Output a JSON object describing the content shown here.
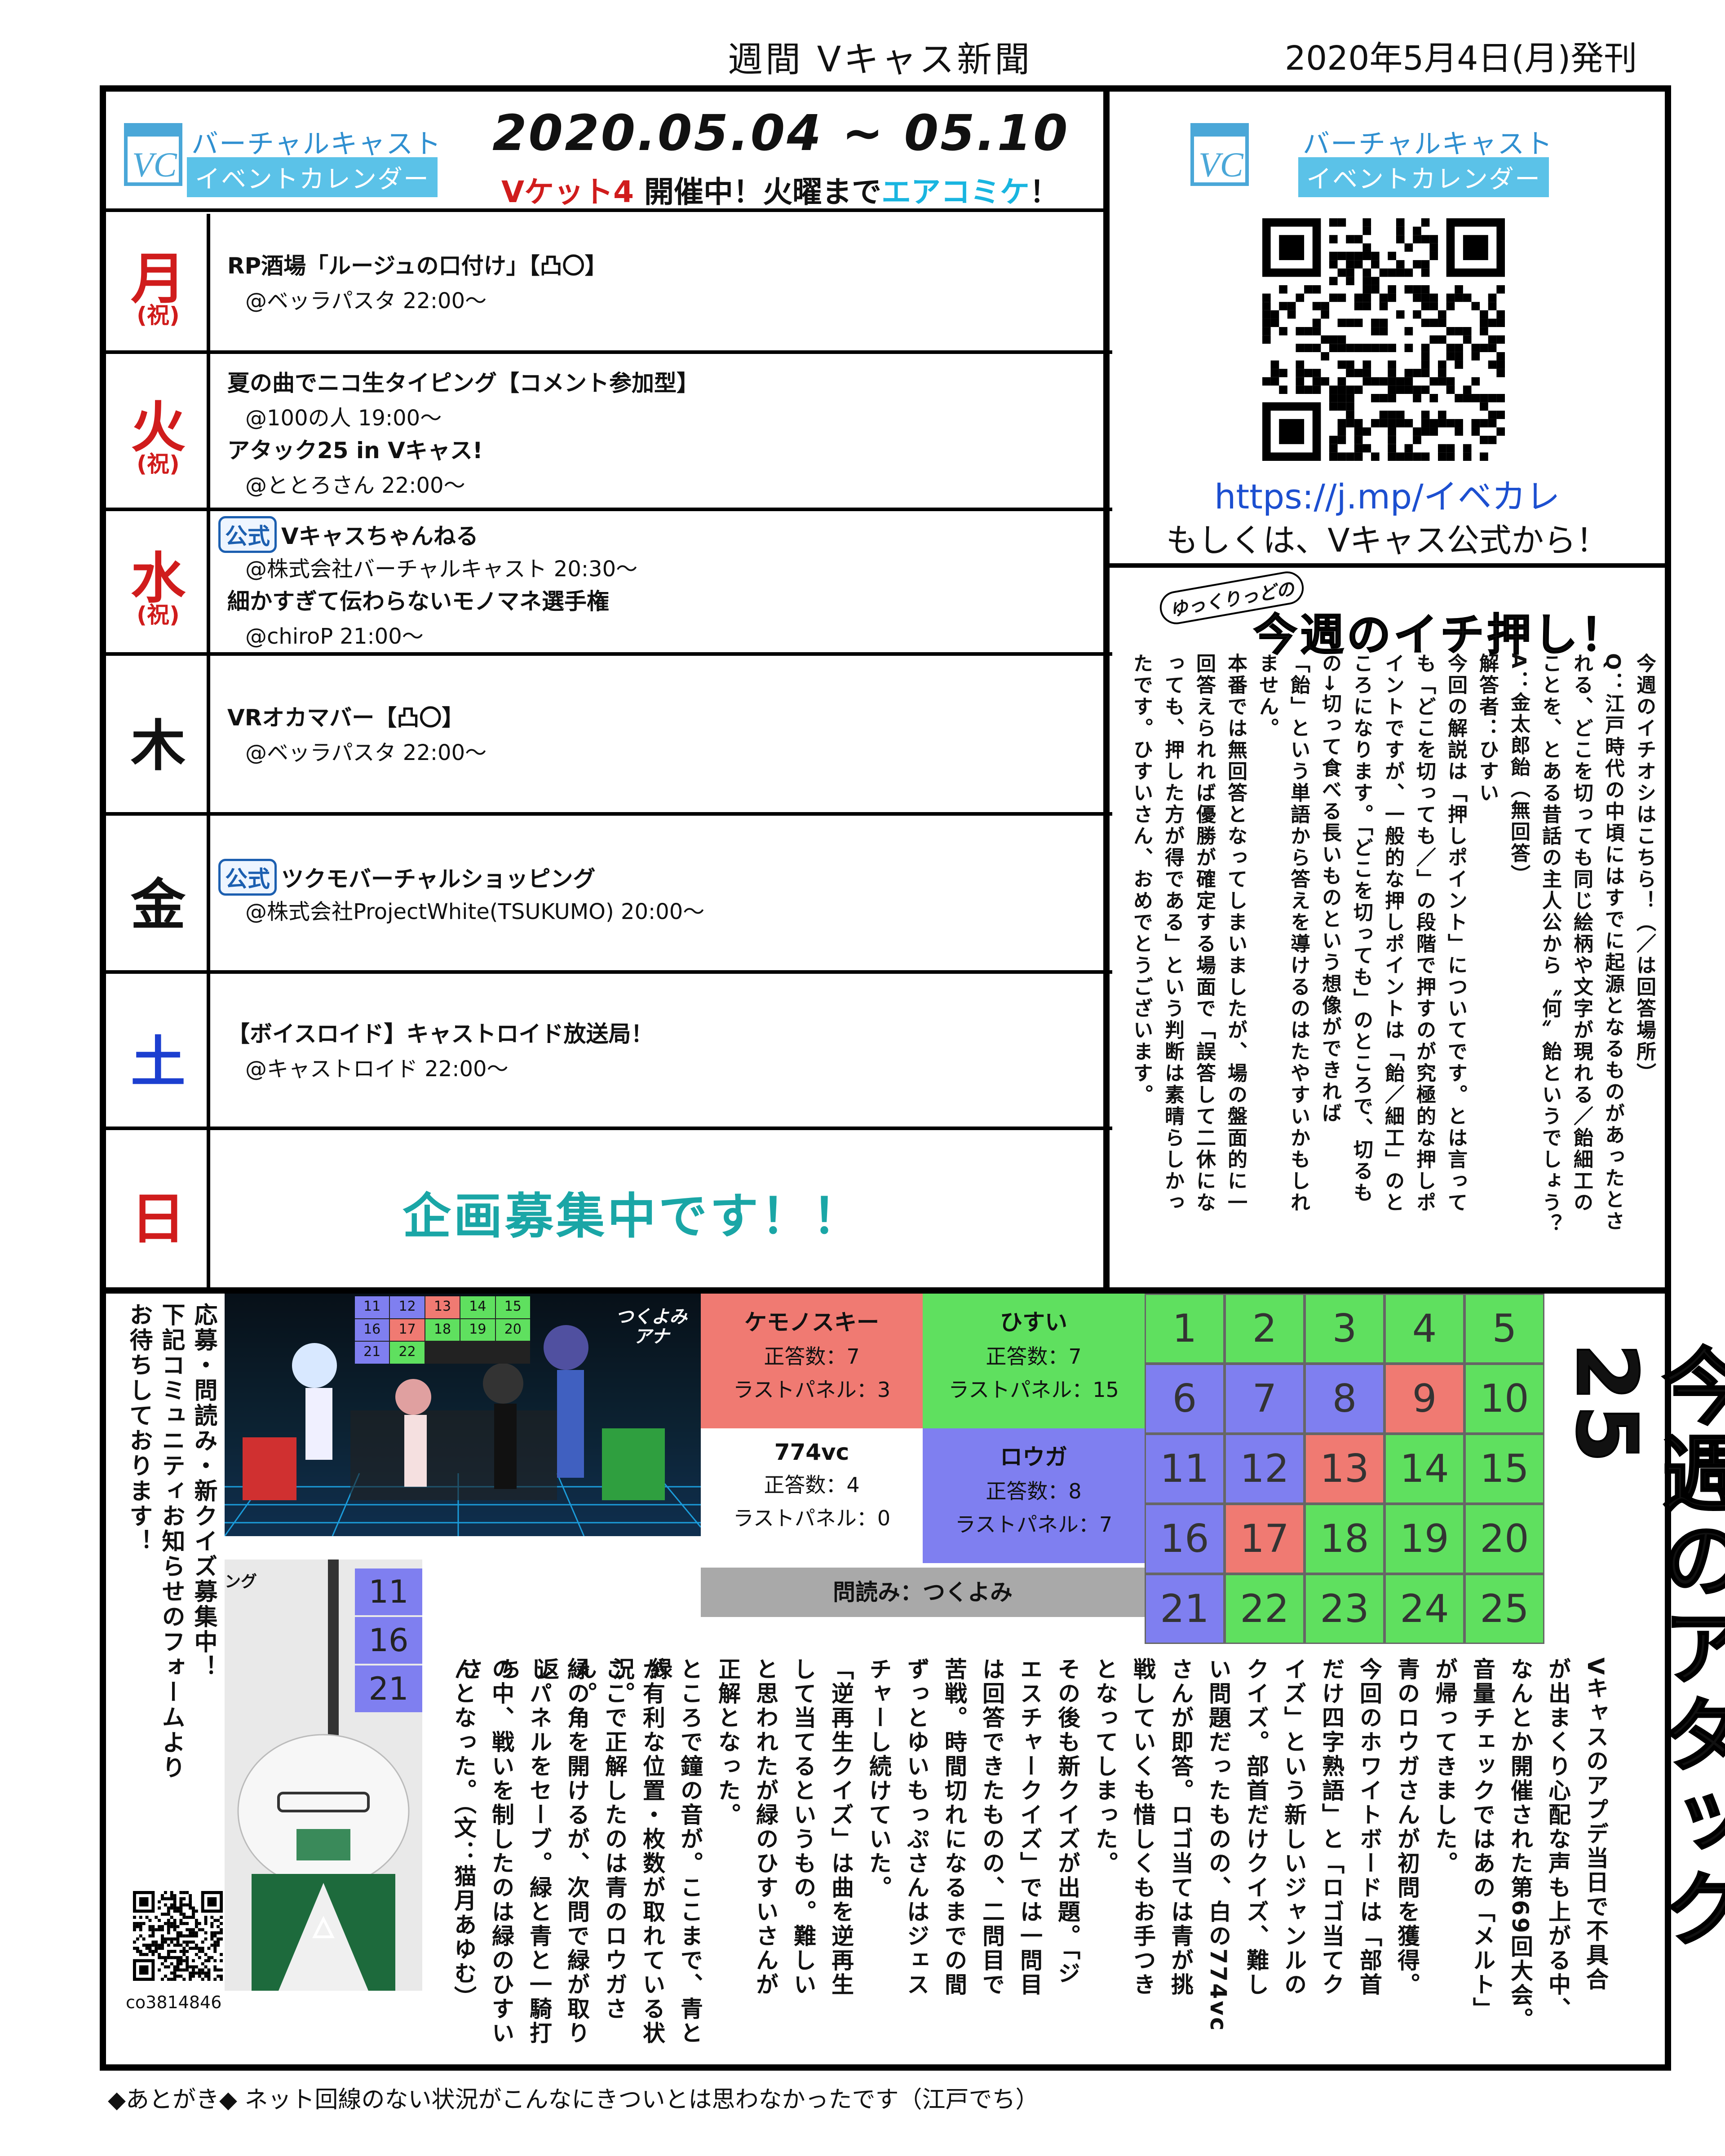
{
  "masthead": {
    "title": "週間 Vキャス新聞",
    "date": "2020年5月4日(月)発刊"
  },
  "logo": {
    "mark": "VC",
    "line1": "バーチャルキャスト",
    "line2": "イベントカレンダー"
  },
  "header": {
    "date_range": "2020.05.04 ~ 05.10",
    "notice_part1": "Vケット4",
    "notice_part2": " 開催中！火曜まで",
    "notice_part3": "エアコミケ",
    "notice_part4": "！"
  },
  "schedule": [
    {
      "day": "月",
      "holiday": "(祝)",
      "color": "#d01c1c",
      "events": [
        {
          "official": "",
          "title": "RP酒場「ルージュの口付け」【凸〇】",
          "host": "@ベッラパスタ 22:00～"
        }
      ]
    },
    {
      "day": "火",
      "holiday": "(祝)",
      "color": "#d01c1c",
      "events": [
        {
          "official": "",
          "title": "夏の曲でニコ生タイピング【コメント参加型】",
          "host": "@100の人 19:00～"
        },
        {
          "official": "",
          "title": "アタック25 in Vキャス!",
          "host": "@ととろさん 22:00～"
        }
      ]
    },
    {
      "day": "水",
      "holiday": "(祝)",
      "color": "#d01c1c",
      "events": [
        {
          "official": "公式",
          "title": "Vキャスちゃんねる",
          "host": "@株式会社バーチャルキャスト 20:30～"
        },
        {
          "official": "",
          "title": "細かすぎて伝わらないモノマネ選手権",
          "host": "@chiroP 21:00～"
        }
      ]
    },
    {
      "day": "木",
      "holiday": "",
      "color": "#111111",
      "events": [
        {
          "official": "",
          "title": "VRオカマバー【凸〇】",
          "host": "@ベッラパスタ 22:00～"
        }
      ]
    },
    {
      "day": "金",
      "holiday": "",
      "color": "#111111",
      "events": [
        {
          "official": "公式",
          "title": "ツクモバーチャルショッピング",
          "host": "@株式会社ProjectWhite(TSUKUMO) 20:00～"
        }
      ]
    },
    {
      "day": "土",
      "holiday": "",
      "color": "#1c3fd0",
      "events": [
        {
          "official": "",
          "title": "【ボイスロイド】キャストロイド放送局！",
          "host": "@キャストロイド 22:00～"
        }
      ]
    },
    {
      "day": "日",
      "holiday": "",
      "color": "#d01c1c",
      "events": [],
      "recruit": "企画募集中です！！"
    }
  ],
  "qr_panel": {
    "url": "https://j.mp/イベカレ",
    "alt_text": "もしくは、Vキャス公式から！"
  },
  "pick": {
    "badge": "ゆっくりっどの",
    "title": "今週のイチ押し！",
    "columns": [
      "今週のイチオシはこちら！（／は回答場所）",
      "Q：江戸時代の中頃にはすでに起源となるものがあったとさ",
      "れる、どこを切っても同じ絵柄や文字が現れる／飴細工の",
      "ことを、とある昔話の主人公から〝何〟飴というでしょう？",
      "A：金太郎飴（無回答）",
      "解答者：ひすい",
      "今回の解説は「押しポイント」についてです。とは言って",
      "も「どこを切っても／」の段階で押すのが究極的な押しポ",
      "イントですが、一般的な押しポイントは「飴／細工」のと",
      "ころになります。「どこを切っても」のところで、切るも",
      "の→切って食べる長いものという想像ができれば",
      "「飴」という単語から答えを導けるのはたやすいかもしれ",
      "ません。",
      "本番では無回答となってしまいましたが、場の盤面的に一",
      "回答えられれば優勝が確定する場面で「誤答して二休にな",
      "っても、押した方が得である」という判断は素晴らしかっ",
      "たです。ひすいさん、おめでとうございます。"
    ]
  },
  "attack25": {
    "title": "今週のアタック25",
    "teams": [
      {
        "name": "ケモノスキー",
        "correct": "正答数：7",
        "last": "ラストパネル：3",
        "color": "#f07a72"
      },
      {
        "name": "ひすい",
        "correct": "正答数：7",
        "last": "ラストパネル：15",
        "color": "#5fe05f"
      },
      {
        "name": "774vc",
        "correct": "正答数：4",
        "last": "ラストパネル：0",
        "color": "#ffffff"
      },
      {
        "name": "ロウガ",
        "correct": "正答数：8",
        "last": "ラストパネル：7",
        "color": "#7f7ff0"
      }
    ],
    "reader": "問読み：つくよみ",
    "panels": [
      {
        "n": "1",
        "c": "#5fe05f"
      },
      {
        "n": "2",
        "c": "#5fe05f"
      },
      {
        "n": "3",
        "c": "#5fe05f"
      },
      {
        "n": "4",
        "c": "#5fe05f"
      },
      {
        "n": "5",
        "c": "#5fe05f"
      },
      {
        "n": "6",
        "c": "#7f7ff0"
      },
      {
        "n": "7",
        "c": "#7f7ff0"
      },
      {
        "n": "8",
        "c": "#7f7ff0"
      },
      {
        "n": "9",
        "c": "#f07a72"
      },
      {
        "n": "10",
        "c": "#5fe05f"
      },
      {
        "n": "11",
        "c": "#7f7ff0"
      },
      {
        "n": "12",
        "c": "#7f7ff0"
      },
      {
        "n": "13",
        "c": "#f07a72"
      },
      {
        "n": "14",
        "c": "#5fe05f"
      },
      {
        "n": "15",
        "c": "#5fe05f"
      },
      {
        "n": "16",
        "c": "#7f7ff0"
      },
      {
        "n": "17",
        "c": "#f07a72"
      },
      {
        "n": "18",
        "c": "#5fe05f"
      },
      {
        "n": "19",
        "c": "#5fe05f"
      },
      {
        "n": "20",
        "c": "#5fe05f"
      },
      {
        "n": "21",
        "c": "#7f7ff0"
      },
      {
        "n": "22",
        "c": "#5fe05f"
      },
      {
        "n": "23",
        "c": "#5fe05f"
      },
      {
        "n": "24",
        "c": "#5fe05f"
      },
      {
        "n": "25",
        "c": "#5fe05f"
      }
    ],
    "article_columns": [
      "Vキャスのアプデ当日で不具合",
      "が出まくり心配な声も上がる中、",
      "なんとか開催された第69回大会。",
      "音量チェックではあの「メルト」",
      "が帰ってきました。",
      "青のロウガさんが初問を獲得。",
      "今回のホワイトボードは「部首",
      "だけ四字熟語」と「ロゴ当てク",
      "イズ」という新しいジャンルの",
      "クイズ。部首だけクイズ、難し",
      "い問題だったものの、白の774vc",
      "さんが即答。ロゴ当ては青が挑",
      "戦していくも惜しくもお手つき",
      "となってしまった。",
      "その後も新クイズが出題。「ジ",
      "エスチャークイズ」では一問目",
      "は回答できたものの、二問目で",
      "苦戦。時間切れになるまでの間",
      "ずっとゆいもっぷさんはジェス",
      "チャーし続けていた。",
      "「逆再生クイズ」は曲を逆再生",
      "して当てるというもの。難しい",
      "と思われたが緑のひすいさんが",
      "正解となった。",
      "ところで鐘の音が。ここまで、青と緑",
      "が有利な位置・枚数が取れている状況。",
      "ここで正解したのは青のロウガさん。",
      "緑の角を開けるが、次問で緑が取り返",
      "しパネルをセーブ。緑と青と一騎打ち",
      "の中、戦いを制したのは緑のひすいさ",
      "んとなった。（文：猫月あゆむ）"
    ],
    "recruit_columns": [
      "応募・問読み・新クイズ募集中！",
      "下記コミュニティお知らせのフォームより",
      "お待ちしております！"
    ],
    "community_id": "co3814846",
    "photo_board_nums": [
      "11",
      "12",
      "13",
      "14",
      "15",
      "16",
      "17",
      "18",
      "19",
      "20",
      "21",
      "22"
    ],
    "photo_nameplate": "つくよみ\nアナ",
    "photo2_label": "ング",
    "photo2_nums": [
      "11",
      "16",
      "21"
    ]
  },
  "footer": "◆あとがき◆ ネット回線のない状況がこんなにきついとは思わなかったです（江戸でち）"
}
